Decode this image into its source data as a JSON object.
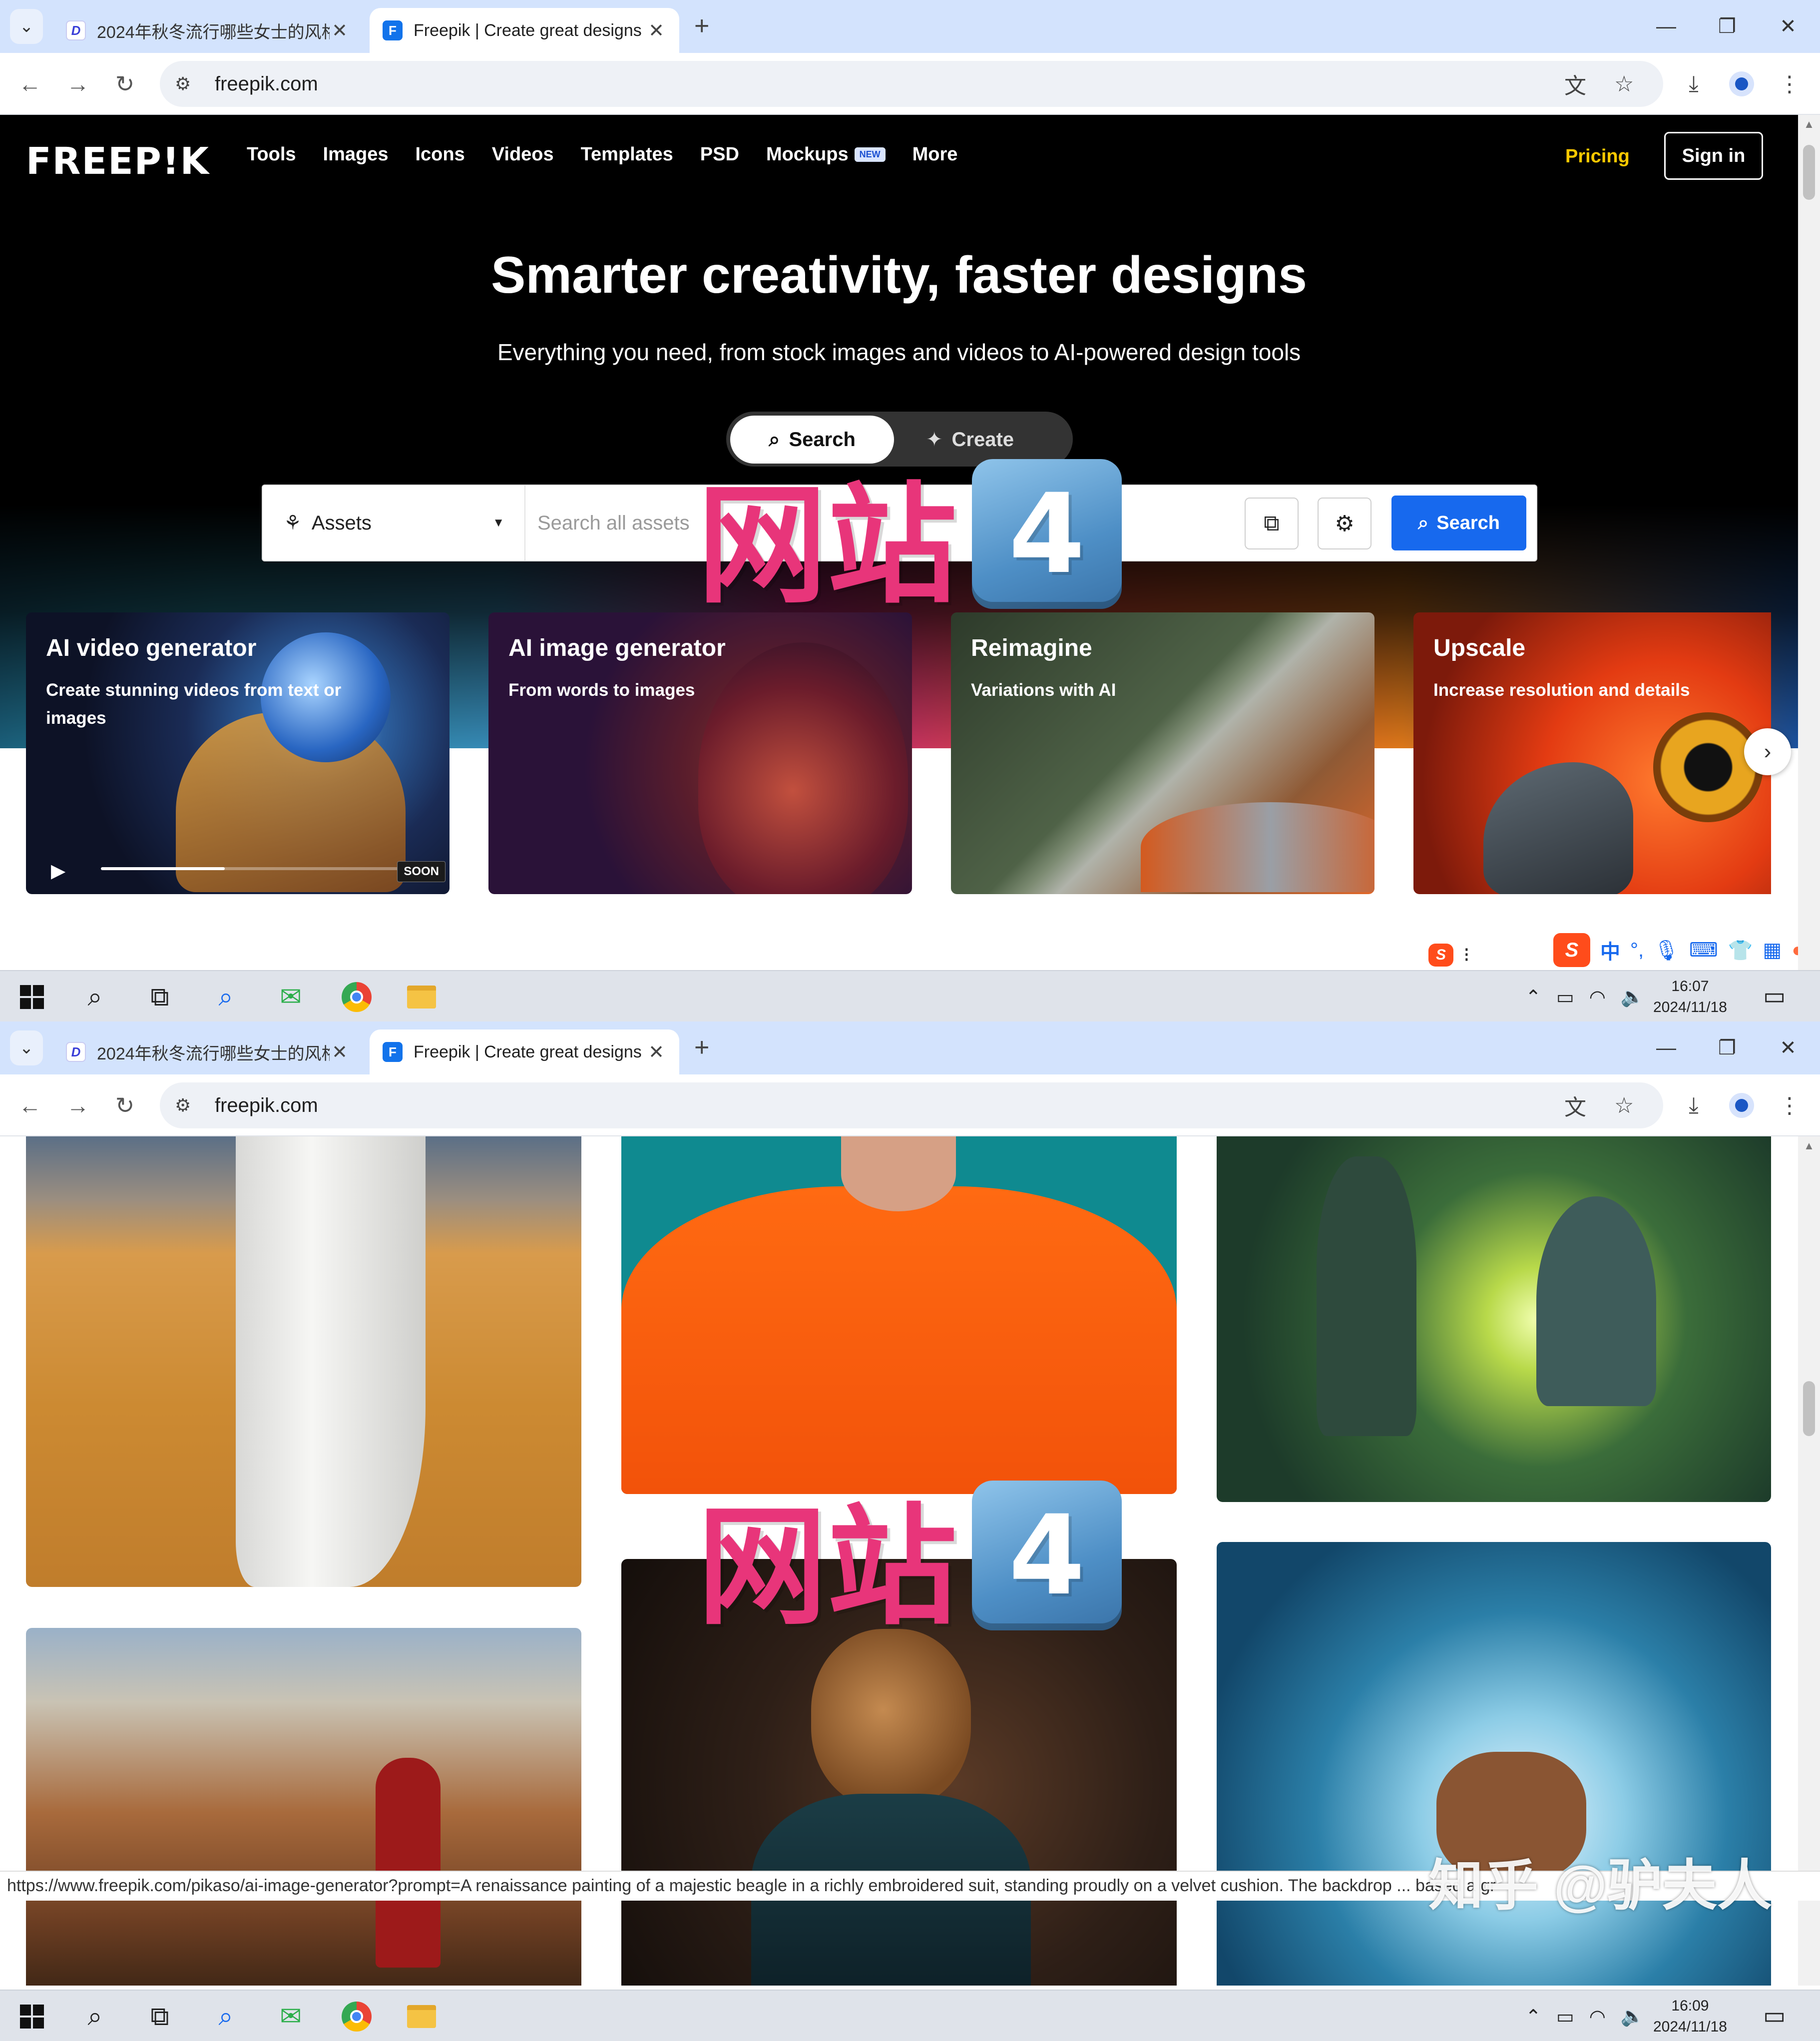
{
  "browser": {
    "tabs": [
      {
        "title": "2024年秋冬流行哪些女士的风格",
        "favicon": "D",
        "active": false
      },
      {
        "title": "Freepik | Create great designs",
        "favicon": "F",
        "active": true
      }
    ],
    "url": "freepik.com",
    "new_tab_symbol": "+",
    "close_symbol": "✕"
  },
  "freepik": {
    "logo": "FREEP!K",
    "nav": [
      "Tools",
      "Images",
      "Icons",
      "Videos",
      "Templates",
      "PSD",
      "Mockups",
      "More"
    ],
    "new_badge": "NEW",
    "pricing": "Pricing",
    "sign_in": "Sign in",
    "hero_title": "Smarter creativity, faster designs",
    "hero_subtitle": "Everything you need, from stock images and videos to AI-powered design tools",
    "mode_search": "Search",
    "mode_create": "Create",
    "asset_filter": "Assets",
    "search_placeholder": "Search all assets",
    "search_button": "Search",
    "cards": [
      {
        "title": "AI video generator",
        "subtitle": "Create stunning videos from text or images",
        "badge": "SOON",
        "progress": 0.4
      },
      {
        "title": "AI image generator",
        "subtitle": "From words to images"
      },
      {
        "title": "Reimagine",
        "subtitle": "Variations with AI"
      },
      {
        "title": "Upscale",
        "subtitle": "Increase resolution and details"
      }
    ]
  },
  "watermark": {
    "text": "网站",
    "number": "4"
  },
  "ime": {
    "mode": "中",
    "punct": "°,"
  },
  "taskbar": {
    "top_time": "16:07",
    "top_date": "2024/11/18",
    "bottom_time": "16:09",
    "bottom_date": "2024/11/18"
  },
  "status_bar": {
    "url": "https://www.freepik.com/pikaso/ai-image-generator?prompt=A renaissance painting of a majestic beagle in a richly embroidered suit, standing proudly on a velvet cushion. The backdrop ... based a gr"
  },
  "corner_watermark": "知乎 @驴夫人",
  "colors": {
    "tab_strip": "#d3e3fd",
    "freepik_blue": "#1769ee",
    "pricing_yellow": "#ffc900",
    "watermark_pink": "#e8357a"
  }
}
